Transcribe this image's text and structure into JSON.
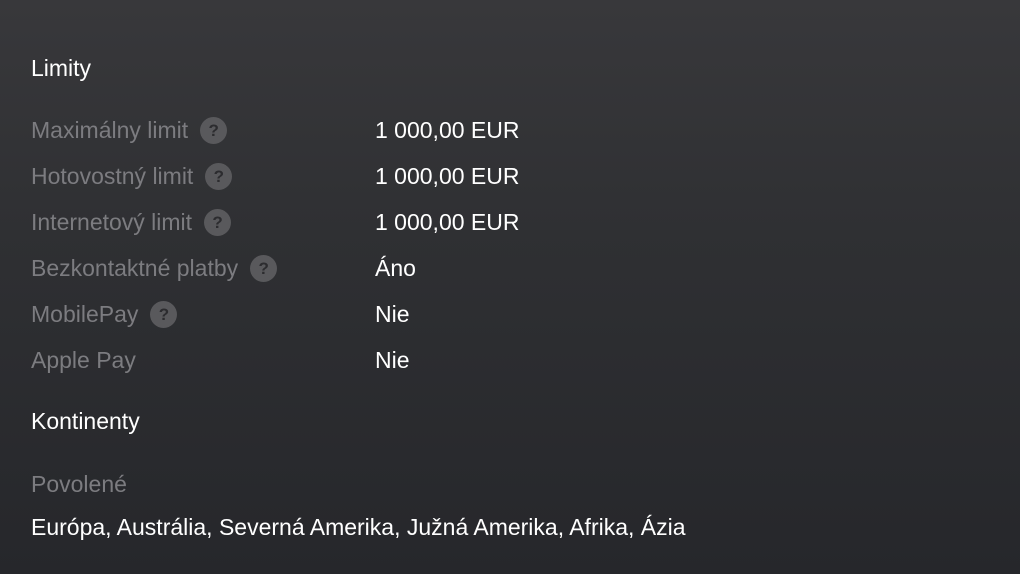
{
  "limits": {
    "title": "Limity",
    "rows": [
      {
        "label": "Maximálny limit",
        "help": "?",
        "value": "1 000,00 EUR"
      },
      {
        "label": "Hotovostný limit",
        "help": "?",
        "value": "1 000,00 EUR"
      },
      {
        "label": "Internetový limit",
        "help": "?",
        "value": "1 000,00 EUR"
      },
      {
        "label": "Bezkontaktné platby",
        "help": "?",
        "value": "Áno"
      },
      {
        "label": "MobilePay",
        "help": "?",
        "value": "Nie"
      },
      {
        "label": "Apple Pay",
        "value": "Nie"
      }
    ]
  },
  "continents": {
    "title": "Kontinenty",
    "allowed_label": "Povolené",
    "allowed_value": "Európa, Austrália, Severná Amerika, Južná Amerika, Afrika, Ázia"
  },
  "icons": {
    "help": "question-mark-icon"
  },
  "colors": {
    "background_top": "#38383b",
    "background_bottom": "#26272b",
    "label": "#7c7c80",
    "value": "#ffffff",
    "help_circle": "#59595c"
  }
}
